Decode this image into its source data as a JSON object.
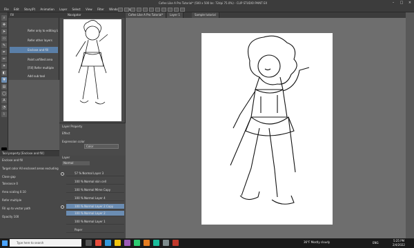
{
  "window": {
    "title": "Cofee Like A Pro Tutorial* (500 x 500 bs: 72dpi 75.0%)  - CLIP STUDIO PAINT EX"
  },
  "menu": [
    "File",
    "Edit",
    "Story(P)",
    "Animation",
    "Layer",
    "Select",
    "View",
    "Filter",
    "Window",
    "Help"
  ],
  "subtool": {
    "header": "Fill",
    "items": [
      "Refer only to editing layer",
      "Refer other layers",
      "Enclose and fill",
      "Paint unfilled area",
      "[Fill] Refer multiple"
    ],
    "add_label": "Add sub tool"
  },
  "navigator": {
    "header": "Navigator"
  },
  "layer_property": {
    "header": "Layer Property",
    "effect": "Effect",
    "expression_color": "Expression color",
    "color_value": "Color"
  },
  "tool_property": {
    "header": "Tool property [Enclose and fill]",
    "subheader": "Enclose and fill",
    "rows": [
      "Target color  All enclosed areas excluding lines",
      "Close gap",
      "Tolerance  0",
      "Area scaling  0.10",
      "Refer multiple",
      "Fill up to vector path",
      "Opacity  100"
    ]
  },
  "layers": {
    "header": "Layer",
    "blend": "Normal",
    "items": [
      {
        "name": "57 % Normal Layer 3",
        "sel": false
      },
      {
        "name": "100 % Normal skin cell",
        "sel": false
      },
      {
        "name": "100 % Normal Mime Copy",
        "sel": false
      },
      {
        "name": "100 % Normal Layer 4",
        "sel": false
      },
      {
        "name": "100 % Normal Layer 2 Copy",
        "sel": true
      },
      {
        "name": "100 % Normal Layer 2",
        "sel": true
      },
      {
        "name": "100 % Normal Layer 1",
        "sel": false
      },
      {
        "name": "Paper",
        "sel": false
      }
    ]
  },
  "tabs": [
    "Cofee Like A Pro Tutorial*",
    "Layer 1",
    "Sample tutorial"
  ],
  "taskbar": {
    "search_placeholder": "Type here to search",
    "weather": "36°F  Mostly cloudy",
    "lang": "ENG",
    "time": "5:25 PM",
    "date": "2/4/2022"
  }
}
